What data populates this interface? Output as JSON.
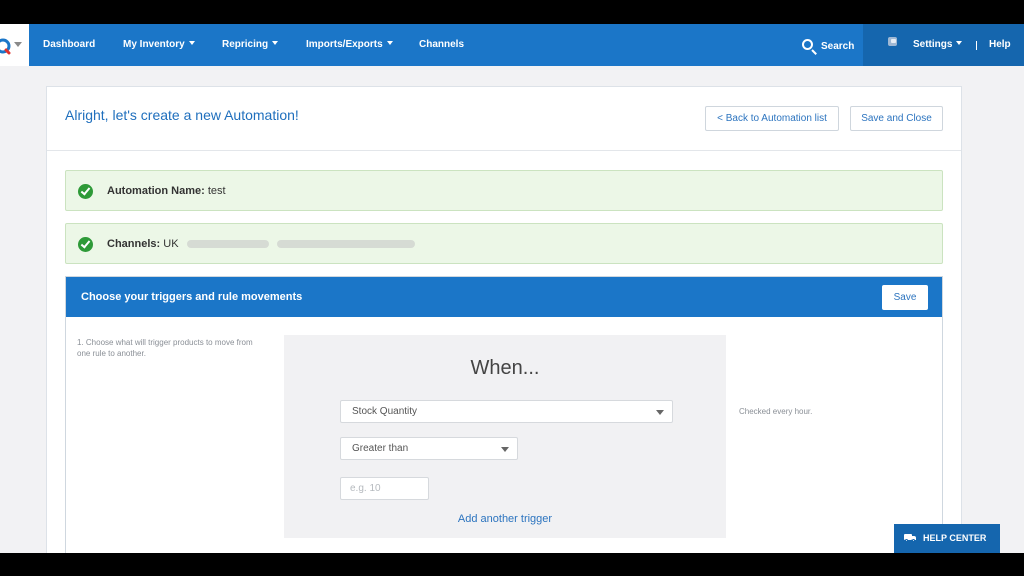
{
  "nav": {
    "items": [
      {
        "label": "Dashboard",
        "dropdown": false
      },
      {
        "label": "My Inventory",
        "dropdown": true
      },
      {
        "label": "Repricing",
        "dropdown": true
      },
      {
        "label": "Imports/Exports",
        "dropdown": true
      },
      {
        "label": "Channels",
        "dropdown": false
      }
    ],
    "search_label": "Search",
    "settings_label": "Settings",
    "help_label": "Help"
  },
  "page": {
    "title": "Alright, let's create a new Automation!",
    "back_button": "< Back to Automation list",
    "save_close_button": "Save and Close"
  },
  "summary": {
    "name_label": "Automation Name:",
    "name_value": "test",
    "channels_label": "Channels:",
    "channels_value": "UK"
  },
  "rules": {
    "header": "Choose your triggers and rule movements",
    "save_button": "Save",
    "step_description": "1. Choose what will trigger products to move from one rule to another.",
    "when_label": "When...",
    "trigger_field": "Stock Quantity",
    "operator": "Greater than",
    "value_placeholder": "e.g. 10",
    "add_trigger": "Add another trigger",
    "check_note": "Checked every hour."
  },
  "help_center": "HELP CENTER",
  "colors": {
    "primary": "#1b76c8",
    "primary_dark": "#1566ae",
    "success_bg": "#ecf7e7",
    "success_check": "#2e9a38",
    "link": "#2c74bf"
  }
}
